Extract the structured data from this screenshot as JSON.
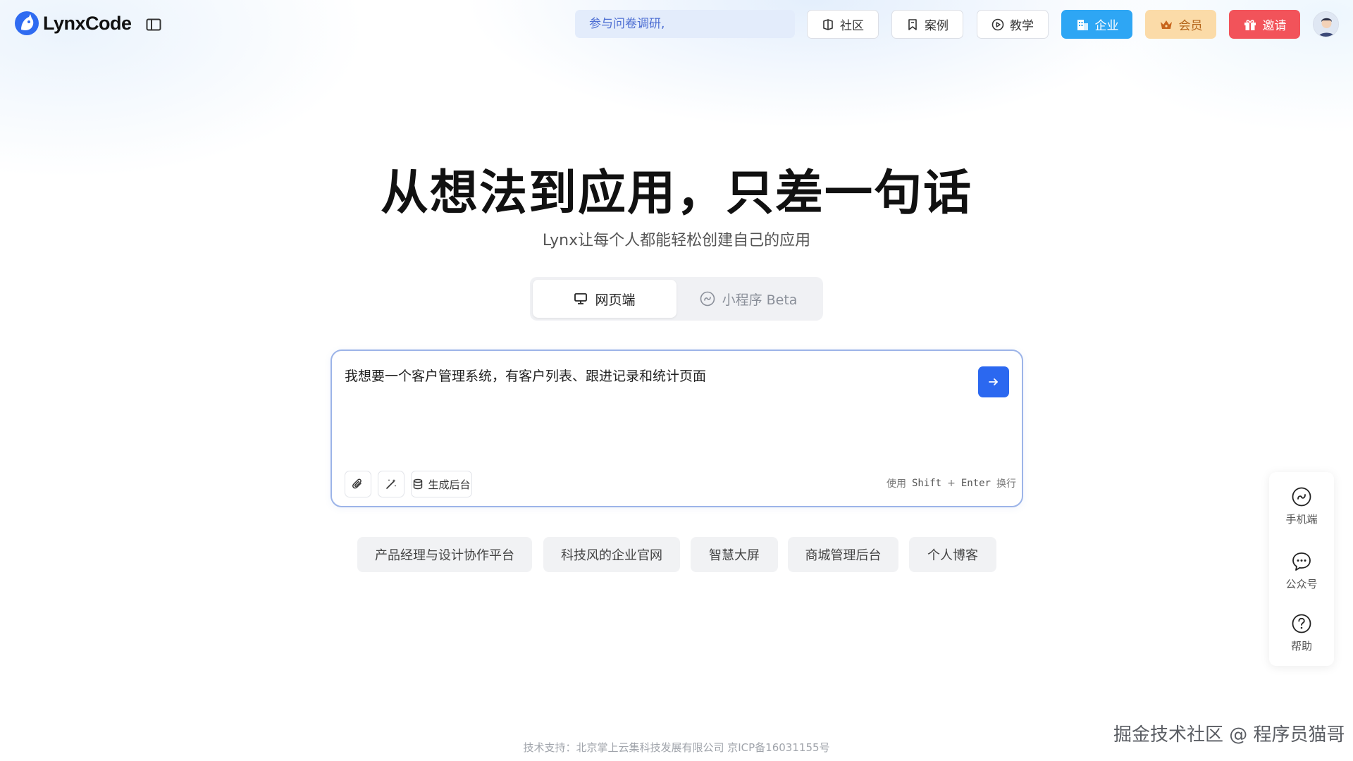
{
  "header": {
    "logo_text": "LynxCode",
    "survey_text": "参与问卷调研,",
    "nav": {
      "community": "社区",
      "cases": "案例",
      "tutorial": "教学",
      "enterprise": "企业",
      "member": "会员",
      "invite": "邀请"
    }
  },
  "hero": {
    "title": "从想法到应用，只差一句话",
    "subtitle": "Lynx让每个人都能轻松创建自己的应用"
  },
  "mode_switch": {
    "tabs": [
      {
        "label": "网页端",
        "active": true
      },
      {
        "label": "小程序 Beta",
        "active": false
      }
    ]
  },
  "prompt": {
    "text": "我想要一个客户管理系统，有客户列表、跟进记录和统计页面",
    "generate_backend_label": "生成后台",
    "hint_prefix": "使用",
    "hint_key1": "Shift",
    "hint_plus": "+",
    "hint_key2": "Enter",
    "hint_suffix": "换行"
  },
  "suggestions": [
    "产品经理与设计协作平台",
    "科技风的企业官网",
    "智慧大屏",
    "商城管理后台",
    "个人博客"
  ],
  "float_panel": {
    "mobile": "手机端",
    "official_account": "公众号",
    "help": "帮助"
  },
  "footer": {
    "text": "技术支持：北京掌上云集科技发展有限公司    京ICP备16031155号"
  },
  "watermark": "掘金技术社区 @ 程序员猫哥",
  "colors": {
    "primary": "#2b68f0",
    "enterprise": "#2ea6f4",
    "member_bg": "#fbdba8",
    "invite": "#f2535a",
    "survey_bg": "#e3ecfb"
  }
}
